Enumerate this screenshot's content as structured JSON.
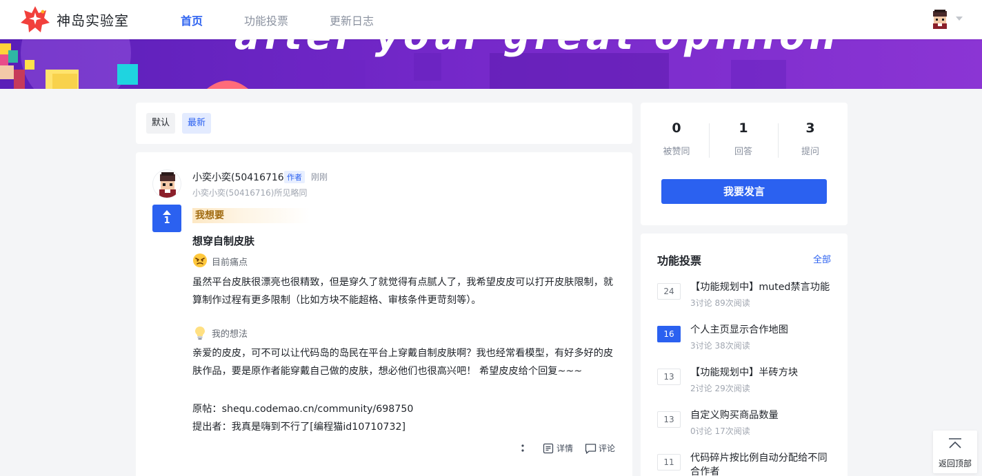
{
  "header": {
    "brand": "神岛实验室",
    "nav": [
      {
        "label": "首页",
        "active": true
      },
      {
        "label": "功能投票",
        "active": false
      },
      {
        "label": "更新日志",
        "active": false
      }
    ]
  },
  "sort": {
    "options": [
      "默认",
      "最新"
    ],
    "selected": "最新"
  },
  "post": {
    "author": "小奕小奕(50416716)",
    "author_tag": "作者",
    "time": "刚刚",
    "subtitle": "小奕小奕(50416716)所见略同",
    "votes": "1",
    "tag": "我想要",
    "title": "想穿自制皮肤",
    "pain_label": "目前痛点",
    "pain_text": "虽然平台皮肤很漂亮也很精致，但是穿久了就觉得有点腻人了，我希望皮皮可以打开皮肤限制，就算制作过程有更多限制（比如方块不能超格、审核条件更苛刻等）。",
    "idea_label": "我的想法",
    "idea_text": "亲爱的皮皮，可不可以让代码岛的岛民在平台上穿戴自制皮肤啊？我也经常看模型，有好多好的皮肤作品，要是原作者能穿戴自己做的皮肤，想必他们也很高兴吧！ 希望皮皮给个回复~~~",
    "source_line": "原帖：shequ.codemao.cn/community/698750",
    "proposer_line": "提出者：我真是嗨到不行了[编程猫id10710732]",
    "actions": {
      "detail": "详情",
      "comment": "评论"
    }
  },
  "stats": [
    {
      "value": "0",
      "label": "被赞同"
    },
    {
      "value": "1",
      "label": "回答"
    },
    {
      "value": "3",
      "label": "提问"
    }
  ],
  "speak_button": "我要发言",
  "feature_vote": {
    "title": "功能投票",
    "all": "全部",
    "items": [
      {
        "count": "24",
        "title": "【功能规划中】muted禁言功能",
        "meta": "3讨论  89次阅读",
        "active": false
      },
      {
        "count": "16",
        "title": "个人主页显示合作地图",
        "meta": "3讨论  38次阅读",
        "active": true
      },
      {
        "count": "13",
        "title": "【功能规划中】半砖方块",
        "meta": "2讨论  29次阅读",
        "active": false
      },
      {
        "count": "13",
        "title": "自定义购买商品数量",
        "meta": "0讨论  17次阅读",
        "active": false
      },
      {
        "count": "11",
        "title": "代码碎片按比例自动分配给不同合作者",
        "meta": "",
        "active": false
      }
    ]
  },
  "back_to_top": "返回顶部",
  "colors": {
    "accent": "#2b61f0",
    "banner": "#7b2fd0"
  }
}
